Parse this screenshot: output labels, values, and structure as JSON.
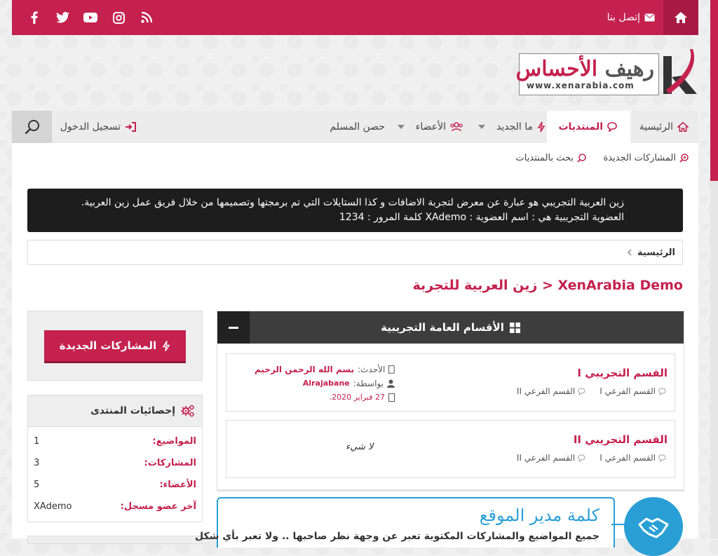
{
  "colors": {
    "brand": "#c4214f",
    "dark": "#3d3d3d",
    "notice_bg": "#1d1d1d",
    "admin_blue": "#2a9fd6"
  },
  "topbar": {
    "home_icon": "home-icon",
    "contact_label": "إتصل بنا",
    "social": [
      "facebook-icon",
      "twitter-icon",
      "youtube-icon",
      "instagram-icon",
      "rss-icon"
    ]
  },
  "logo": {
    "name_main": "رهيف ",
    "name_accent": "الأحساس",
    "url": "www.xenarabia.com"
  },
  "nav": {
    "home": "الرئيسية",
    "forums": "المنتديات",
    "whats_new": "ما الجديد",
    "members": "الأعضاء",
    "hisn": "حصن المسلم",
    "login": "تسجيل الدخول"
  },
  "subnav": {
    "new_posts": "المشاركات الجديدة",
    "search_forums": "بحث بالمنتديات"
  },
  "notice": {
    "line1": "زين العربية التجريبي هو عبارة عن معرض لتجربة الاضافات و كذا الستايلات التي تم برمجتها وتصميمها من خلال فريق عمل زين العربية.",
    "line2": "العضوية التجريبية هي : اسم العضوية : XAdemo كلمة المرور : 1234"
  },
  "breadcrumb": {
    "home": "الرئيسية"
  },
  "page": {
    "title": "XenArabia Demo < زين العربية للتجربة"
  },
  "category": {
    "title": "الأقسام العامة التجريبية",
    "nodes": [
      {
        "title": "القسم التجريبي I",
        "subs": [
          "القسم الفرعي I",
          "القسم الفرعي II"
        ],
        "latest_label": "الأحدث:",
        "latest_title": "بسم الله الرحمن الرحيم",
        "by_label": "بواسطة:",
        "by_user": "Alrajabane",
        "date": "27 فبراير 2020."
      },
      {
        "title": "القسم التجريبي II",
        "subs": [
          "القسم الفرعي I",
          "القسم الفرعي II"
        ],
        "none_label": "لا شيء"
      }
    ]
  },
  "sidebar": {
    "new_posts_button": "المشاركات الجديدة",
    "stats_title": "إحصائيات المنتدى",
    "stats": [
      {
        "k": "المواضيع:",
        "v": "1"
      },
      {
        "k": "المشاركات:",
        "v": "3"
      },
      {
        "k": "الأعضاء:",
        "v": "5"
      },
      {
        "k": "آخر عضو مسجل:",
        "v": "XAdemo"
      }
    ]
  },
  "admin_word": {
    "title": "كلمة مدير الموقع",
    "body": "جميع المواضيع والمشاركات المكتوبة تعبر عن وجهة نظر صاحبها .. ولا تعبر بأي شكل"
  }
}
